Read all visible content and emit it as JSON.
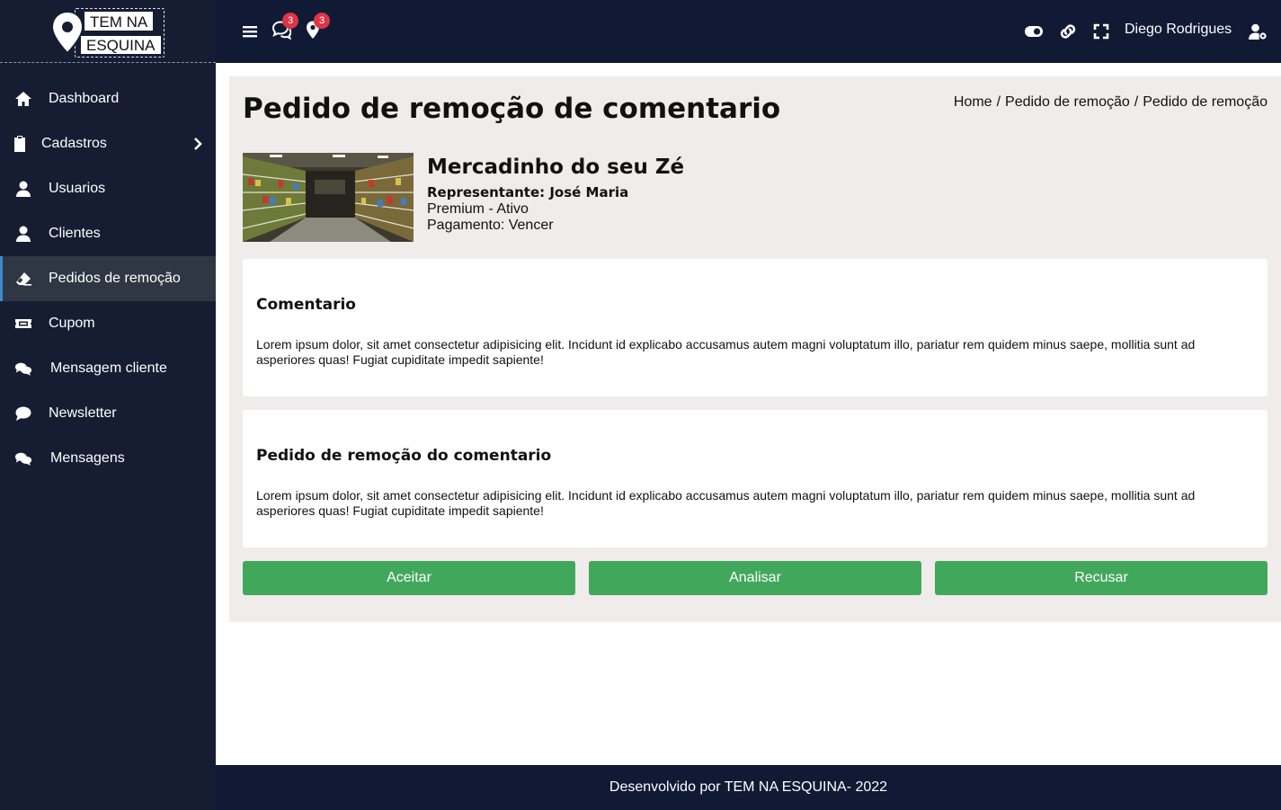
{
  "logo": {
    "line1": "TEM NA",
    "line2": "ESQUINA"
  },
  "sidebar": {
    "items": [
      {
        "label": "Dashboard",
        "icon": "home-icon"
      },
      {
        "label": "Cadastros",
        "icon": "clipboard-icon"
      },
      {
        "label": "Usuarios",
        "icon": "user-icon"
      },
      {
        "label": "Clientes",
        "icon": "user-icon"
      },
      {
        "label": "Pedidos de remoção",
        "icon": "eraser-icon"
      },
      {
        "label": "Cupom",
        "icon": "ticket-icon"
      },
      {
        "label": "Mensagem cliente",
        "icon": "comments-icon"
      },
      {
        "label": "Newsletter",
        "icon": "comment-icon"
      },
      {
        "label": "Mensagens",
        "icon": "comments-icon"
      }
    ],
    "active_index": 4
  },
  "topbar": {
    "comments_badge": "3",
    "location_badge": "3",
    "user_name": "Diego Rodrigues"
  },
  "page": {
    "title": "Pedido de remoção de comentario",
    "breadcrumb": [
      "Home",
      "Pedido de remoção",
      "Pedido de remoção"
    ]
  },
  "store": {
    "name": "Mercadinho do seu Zé",
    "representative": "Representante: José Maria",
    "plan": "Premium - Ativo",
    "payment": "Pagamento: Vencer"
  },
  "comment_card": {
    "title": "Comentario",
    "text": "Lorem ipsum dolor, sit amet consectetur adipisicing elit. Incidunt id explicabo accusamus autem magni voluptatum illo, pariatur rem quidem minus saepe, mollitia sunt ad asperiores quas! Fugiat cupiditate impedit sapiente!"
  },
  "request_card": {
    "title": "Pedido de remoção do comentario",
    "text": "Lorem ipsum dolor, sit amet consectetur adipisicing elit. Incidunt id explicabo accusamus autem magni voluptatum illo, pariatur rem quidem minus saepe, mollitia sunt ad asperiores quas! Fugiat cupiditate impedit sapiente!"
  },
  "actions": {
    "accept": "Aceitar",
    "analyze": "Analisar",
    "reject": "Recusar",
    "color": "#41a85b"
  },
  "footer": {
    "text": "Desenvolvido por TEM NA ESQUINA- 2022"
  }
}
